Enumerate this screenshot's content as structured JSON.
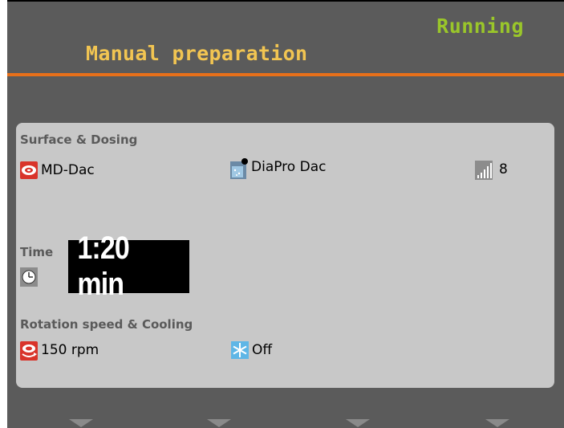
{
  "header": {
    "status": "Running",
    "title": "Manual preparation"
  },
  "surface_dosing": {
    "label": "Surface & Dosing",
    "surface": "MD-Dac",
    "suspension": "DiaPro Dac",
    "dosing_level": "8"
  },
  "time": {
    "label": "Time",
    "value": "1:20 min"
  },
  "rotation_cooling": {
    "label": "Rotation speed & Cooling",
    "speed": "150 rpm",
    "cooling": "Off"
  },
  "icons": {
    "surface": "disc-icon",
    "suspension": "bottle-icon",
    "dosing": "signal-bars-icon",
    "time": "clock-icon",
    "speed": "rotation-icon",
    "cooling": "snowflake-icon"
  },
  "colors": {
    "status": "#9ac62a",
    "title": "#f2c552",
    "accent_line": "#e8701a",
    "background": "#5b5b5b",
    "panel": "#c8c8c8"
  }
}
